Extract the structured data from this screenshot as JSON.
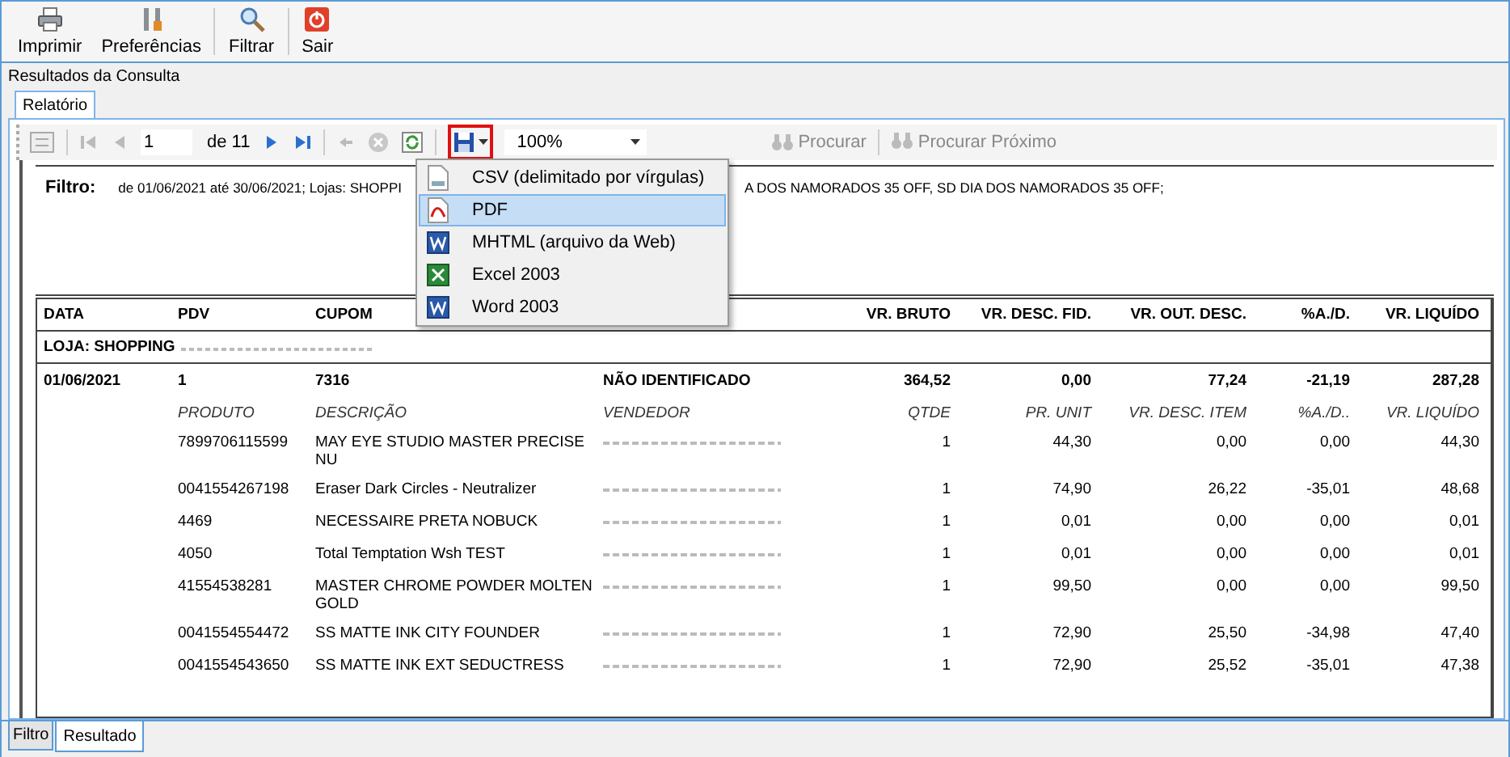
{
  "toolbar": [
    {
      "label": "Imprimir",
      "kind": "print"
    },
    {
      "label": "Preferências",
      "kind": "preferences"
    },
    {
      "label": "Filtrar",
      "kind": "filter"
    },
    {
      "label": "Sair",
      "kind": "exit"
    }
  ],
  "section_title": "Resultados da Consulta",
  "tabs": [
    {
      "label": "Relatório",
      "selected": true
    }
  ],
  "report_toolbar": {
    "page": "1",
    "page_count": "de 11",
    "export_highlighted": true,
    "zoom": "100%",
    "find": "Procurar",
    "find_next": "Procurar Próximo"
  },
  "export_menu": [
    {
      "label": "CSV (delimitado por vírgulas)",
      "kind": "csv",
      "selected": false
    },
    {
      "label": "PDF",
      "kind": "pdf",
      "selected": true
    },
    {
      "label": "MHTML (arquivo da Web)",
      "kind": "word",
      "selected": false
    },
    {
      "label": "Excel 2003",
      "kind": "excel",
      "selected": false
    },
    {
      "label": "Word 2003",
      "kind": "word",
      "selected": false
    }
  ],
  "filter": {
    "label": "Filtro:",
    "text_start": "de 01/06/2021 até 30/06/2021; Lojas: SHOPPI",
    "text_end": "A DOS NAMORADOS 35 OFF, SD DIA DOS NAMORADOS 35 OFF;"
  },
  "table": {
    "columns": [
      "DATA",
      "PDV",
      "CUPOM",
      "VR. BRUTO",
      "VR. DESC. FID.",
      "VR. OUT. DESC.",
      "%A./D.",
      "VR. LIQUÍDO"
    ],
    "store": "LOJA: SHOPPING",
    "sale": {
      "data": "01/06/2021",
      "pdv": "1",
      "cupom": "7316",
      "cliente": "NÃO IDENTIFICADO",
      "vr_bruto": "364,52",
      "vr_desc_fid": "0,00",
      "vr_out_desc": "77,24",
      "pct": "-21,19",
      "vr_liquido": "287,28"
    },
    "item_columns": [
      "PRODUTO",
      "DESCRIÇÃO",
      "VENDEDOR",
      "QTDE",
      "PR. UNIT",
      "VR. DESC. ITEM",
      "%A./D..",
      "VR. LIQUÍDO"
    ],
    "items": [
      {
        "produto": "7899706115599",
        "descricao": "MAY EYE STUDIO MASTER PRECISE NU",
        "qtde": "1",
        "pr_unit": "44,30",
        "vr_desc_item": "0,00",
        "pct": "0,00",
        "vr_liquido": "44,30"
      },
      {
        "produto": "0041554267198",
        "descricao": "Eraser Dark Circles - Neutralizer",
        "qtde": "1",
        "pr_unit": "74,90",
        "vr_desc_item": "26,22",
        "pct": "-35,01",
        "vr_liquido": "48,68"
      },
      {
        "produto": "4469",
        "descricao": "NECESSAIRE PRETA NOBUCK",
        "qtde": "1",
        "pr_unit": "0,01",
        "vr_desc_item": "0,00",
        "pct": "0,00",
        "vr_liquido": "0,01"
      },
      {
        "produto": "4050",
        "descricao": "Total Temptation Wsh TEST",
        "qtde": "1",
        "pr_unit": "0,01",
        "vr_desc_item": "0,00",
        "pct": "0,00",
        "vr_liquido": "0,01"
      },
      {
        "produto": "41554538281",
        "descricao": "MASTER CHROME POWDER MOLTEN GOLD",
        "qtde": "1",
        "pr_unit": "99,50",
        "vr_desc_item": "0,00",
        "pct": "0,00",
        "vr_liquido": "99,50"
      },
      {
        "produto": "0041554554472",
        "descricao": "SS MATTE INK CITY FOUNDER",
        "qtde": "1",
        "pr_unit": "72,90",
        "vr_desc_item": "25,50",
        "pct": "-34,98",
        "vr_liquido": "47,40"
      },
      {
        "produto": "0041554543650",
        "descricao": "SS MATTE INK EXT SEDUCTRESS",
        "qtde": "1",
        "pr_unit": "72,90",
        "vr_desc_item": "25,52",
        "pct": "-35,01",
        "vr_liquido": "47,38"
      }
    ]
  },
  "bottom_tabs": [
    {
      "label": "Filtro",
      "selected": false
    },
    {
      "label": "Resultado",
      "selected": true
    }
  ]
}
